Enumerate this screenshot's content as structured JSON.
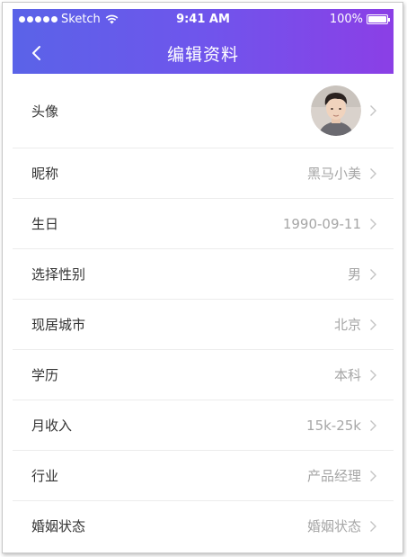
{
  "status_bar": {
    "carrier": "Sketch",
    "time": "9:41 AM",
    "battery": "100%"
  },
  "header": {
    "title": "编辑资料",
    "back_icon": "chevron-left-icon"
  },
  "colors": {
    "header_gradient_start": "#5a63e8",
    "header_gradient_end": "#8b3fe6",
    "label_text": "#333333",
    "value_text": "#a6a6a6",
    "divider": "#ececec"
  },
  "rows": [
    {
      "label": "头像",
      "value": "",
      "type": "avatar"
    },
    {
      "label": "昵称",
      "value": "黑马小美"
    },
    {
      "label": "生日",
      "value": "1990-09-11"
    },
    {
      "label": "选择性别",
      "value": "男"
    },
    {
      "label": "现居城市",
      "value": "北京"
    },
    {
      "label": "学历",
      "value": "本科"
    },
    {
      "label": "月收入",
      "value": "15k-25k"
    },
    {
      "label": "行业",
      "value": "产品经理"
    },
    {
      "label": "婚姻状态",
      "value": "婚姻状态"
    }
  ]
}
